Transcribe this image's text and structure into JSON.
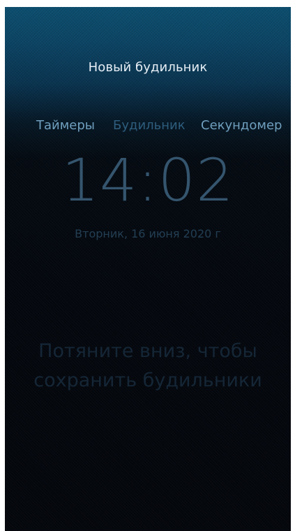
{
  "pulley_menu": {
    "new_alarm_label": "Новый будильник"
  },
  "tabs": [
    {
      "label": "Таймеры",
      "active": false
    },
    {
      "label": "Будильник",
      "active": true
    },
    {
      "label": "Секундомер",
      "active": false
    }
  ],
  "clock": {
    "time": "14:02",
    "date": "Вторник, 16 июня 2020 г"
  },
  "empty_state": {
    "line1": "Потяните вниз, чтобы",
    "line2": "сохранить будильники"
  },
  "colors": {
    "header_top": "#0d4f70",
    "background": "#04070c",
    "tab_inactive": "#6f9fbe",
    "tab_active": "#2e5d7d"
  }
}
